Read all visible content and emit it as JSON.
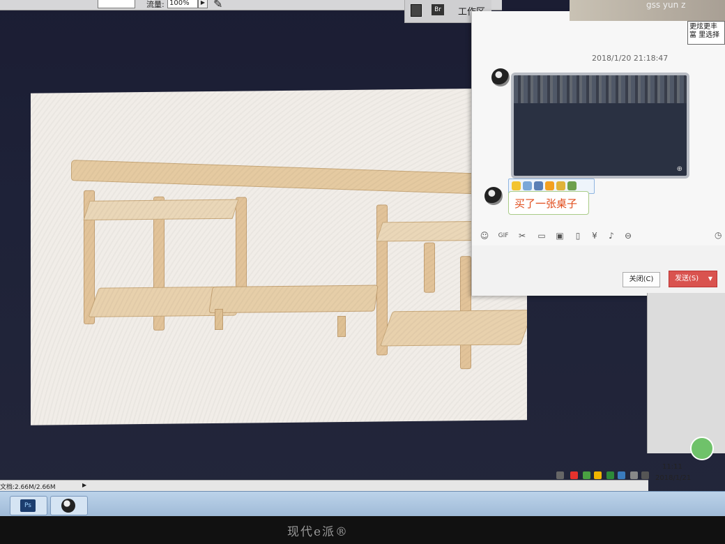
{
  "ps": {
    "flow_label": "流量:",
    "flow_value": "100%",
    "workspace_label": "工作区",
    "status_doc": "文档:2.66M/2.66M",
    "taskbar_ps": "Ps"
  },
  "chat": {
    "username": "gss yun z",
    "timestamp": "2018/1/20 21:18:47",
    "message_text": "买了一张桌子",
    "close_button": "关闭(C)",
    "send_button": "发送(S)"
  },
  "side_note": "更炫更丰富 里选择",
  "tray": {
    "time": "11:11",
    "date": "2018/1/21"
  },
  "monitor": {
    "brand": "现代e派®"
  }
}
